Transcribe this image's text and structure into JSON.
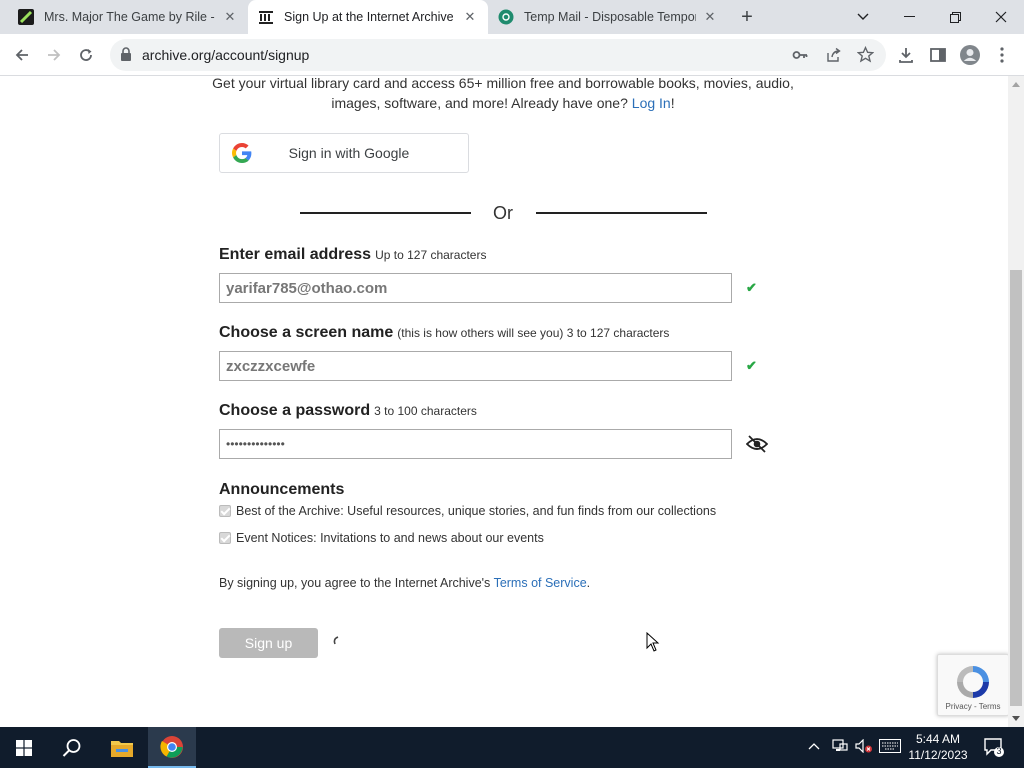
{
  "browser": {
    "tabs": [
      {
        "title": "Mrs. Major The Game by Rile - G",
        "active": false
      },
      {
        "title": "Sign Up at the Internet Archive",
        "active": true
      },
      {
        "title": "Temp Mail - Disposable Tempor",
        "active": false
      }
    ],
    "new_tab_label": "+",
    "url": "archive.org/account/signup"
  },
  "page": {
    "intro_text": "Get your virtual library card and access 65+ million free and borrowable books, movies, audio, images, software, and more! Already have one?",
    "login_link": "Log In",
    "login_suffix": "!",
    "google_button": "Sign in with Google",
    "or_text": "Or",
    "email": {
      "label": "Enter email address",
      "hint": "Up to 127 characters",
      "value": "yarifar785@othao.com",
      "valid": true
    },
    "screenname": {
      "label": "Choose a screen name",
      "hint": "(this is how others will see you) 3 to 127 characters",
      "value": "zxczzxcewfe",
      "valid": true
    },
    "password": {
      "label": "Choose a password",
      "hint": "3 to 100 characters",
      "value": "••••••••••••••"
    },
    "announcements": {
      "title": "Announcements",
      "items": [
        {
          "label": "Best of the Archive: Useful resources, unique stories, and fun finds from our collections",
          "checked": true
        },
        {
          "label": "Event Notices: Invitations to and news about our events",
          "checked": true
        }
      ]
    },
    "terms_prefix": "By signing up, you agree to the Internet Archive's",
    "terms_link": "Terms of Service",
    "terms_suffix": ".",
    "signup_button": "Sign up",
    "recaptcha_footer": "Privacy - Terms"
  },
  "taskbar": {
    "time": "5:44 AM",
    "date": "11/12/2023",
    "notification_count": "3"
  },
  "colors": {
    "link": "#2b6fb8",
    "check": "#28a745",
    "taskbar": "#101c2c"
  }
}
